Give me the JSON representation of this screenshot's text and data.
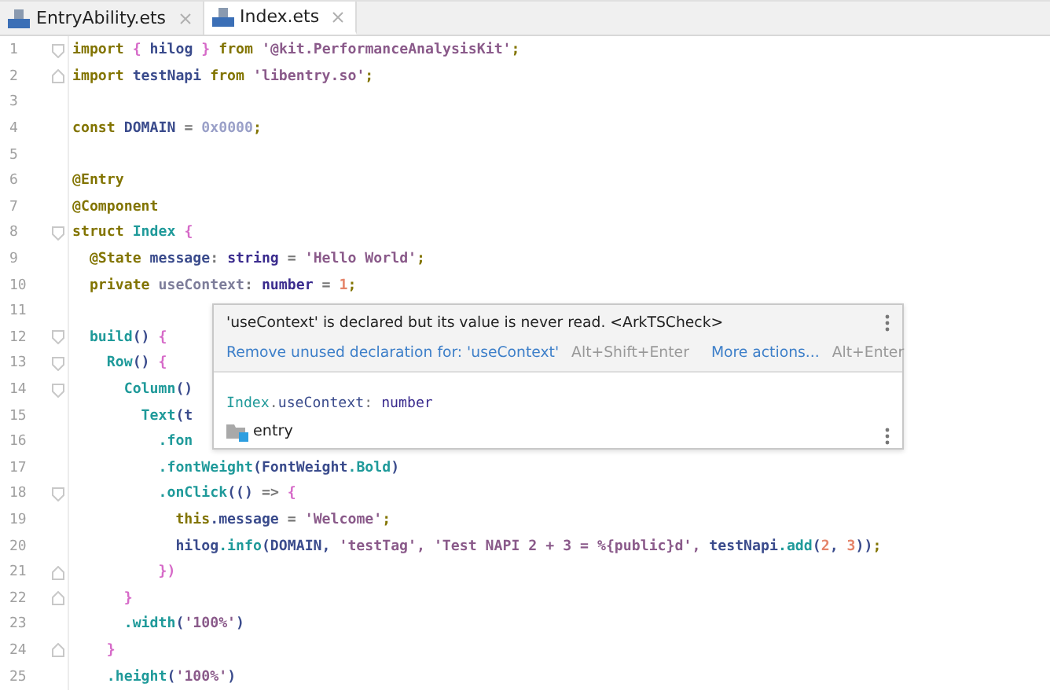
{
  "tabs": [
    {
      "label": "EntryAbility.ets",
      "selected": false
    },
    {
      "label": "Index.ets",
      "selected": true
    }
  ],
  "editor": {
    "lines": [
      {
        "number": "1",
        "kind": "fold_start",
        "tokens": [
          {
            "t": "import",
            "kind": "kw"
          },
          {
            "t": " { ",
            "kind": "brace"
          },
          {
            "t": "hilog",
            "kind": "id"
          },
          {
            "t": " } ",
            "kind": "brace"
          },
          {
            "t": "from",
            "kind": "kw"
          },
          {
            "t": " '@kit.PerformanceAnalysisKit'",
            "kind": "str"
          },
          {
            "t": ";",
            "kind": "kw"
          }
        ]
      },
      {
        "number": "2",
        "kind": "fold_end",
        "tokens": [
          {
            "t": "import",
            "kind": "kw"
          },
          {
            "t": " testNapi ",
            "kind": "id"
          },
          {
            "t": "from",
            "kind": "kw"
          },
          {
            "t": " 'libentry.so'",
            "kind": "str"
          },
          {
            "t": ";",
            "kind": "kw"
          }
        ]
      },
      {
        "number": "3",
        "kind": "plain"
      },
      {
        "number": "4",
        "kind": "plain",
        "tokens": [
          {
            "t": "const",
            "kind": "kw"
          },
          {
            "t": " DOMAIN ",
            "kind": "id"
          },
          {
            "t": "= ",
            "kind": "punct"
          },
          {
            "t": "0x0000",
            "kind": "numlite"
          },
          {
            "t": ";",
            "kind": "kw"
          }
        ]
      },
      {
        "number": "5",
        "kind": "plain"
      },
      {
        "number": "6",
        "kind": "plain",
        "tokens": [
          {
            "t": "@Entry",
            "kind": "kw"
          }
        ]
      },
      {
        "number": "7",
        "kind": "plain",
        "tokens": [
          {
            "t": "@Component",
            "kind": "kw"
          }
        ]
      },
      {
        "number": "8",
        "kind": "fold_start",
        "tokens": [
          {
            "t": "struct",
            "kind": "kw"
          },
          {
            "t": " Index ",
            "kind": "fn"
          },
          {
            "t": "{",
            "kind": "brace"
          }
        ]
      },
      {
        "number": "9",
        "kind": "plain",
        "tokens": [
          {
            "t": "  @State ",
            "kind": "kw"
          },
          {
            "t": "message",
            "kind": "id"
          },
          {
            "t": ": ",
            "kind": "punct"
          },
          {
            "t": "string",
            "kind": "type"
          },
          {
            "t": " = ",
            "kind": "punct"
          },
          {
            "t": "'Hello World'",
            "kind": "str"
          },
          {
            "t": ";",
            "kind": "kw"
          }
        ]
      },
      {
        "number": "10",
        "kind": "plain",
        "tokens": [
          {
            "t": "  private ",
            "kind": "kw"
          },
          {
            "t": "useContext",
            "kind": "unused"
          },
          {
            "t": ": ",
            "kind": "punct"
          },
          {
            "t": "number",
            "kind": "type"
          },
          {
            "t": " = ",
            "kind": "punct"
          },
          {
            "t": "1",
            "kind": "num"
          },
          {
            "t": ";",
            "kind": "kw"
          }
        ]
      },
      {
        "number": "11",
        "kind": "plain"
      },
      {
        "number": "12",
        "kind": "fold_start",
        "tokens": [
          {
            "t": "  build",
            "kind": "fn"
          },
          {
            "t": "() ",
            "kind": "id"
          },
          {
            "t": "{",
            "kind": "brace"
          }
        ]
      },
      {
        "number": "13",
        "kind": "fold_start",
        "tokens": [
          {
            "t": "    Row",
            "kind": "fn"
          },
          {
            "t": "() ",
            "kind": "id"
          },
          {
            "t": "{",
            "kind": "brace"
          }
        ]
      },
      {
        "number": "14",
        "kind": "fold_start",
        "tokens": [
          {
            "t": "      Column",
            "kind": "fn"
          },
          {
            "t": "()",
            "kind": "id"
          }
        ]
      },
      {
        "number": "15",
        "kind": "plain",
        "tokens": [
          {
            "t": "        Text",
            "kind": "fn"
          },
          {
            "t": "(t",
            "kind": "id"
          }
        ]
      },
      {
        "number": "16",
        "kind": "plain",
        "tokens": [
          {
            "t": "          .fon",
            "kind": "fn"
          }
        ]
      },
      {
        "number": "17",
        "kind": "plain",
        "tokens": [
          {
            "t": "          .fontWeight",
            "kind": "fn"
          },
          {
            "t": "(FontWeight",
            "kind": "id"
          },
          {
            "t": ".Bold",
            "kind": "fn"
          },
          {
            "t": ")",
            "kind": "id"
          }
        ]
      },
      {
        "number": "18",
        "kind": "fold_start",
        "tokens": [
          {
            "t": "          .onClick",
            "kind": "fn"
          },
          {
            "t": "(() ",
            "kind": "id"
          },
          {
            "t": "=> ",
            "kind": "punct"
          },
          {
            "t": "{",
            "kind": "brace"
          }
        ]
      },
      {
        "number": "19",
        "kind": "plain",
        "tokens": [
          {
            "t": "            this",
            "kind": "kw"
          },
          {
            "t": ".message ",
            "kind": "id"
          },
          {
            "t": "= ",
            "kind": "punct"
          },
          {
            "t": "'Welcome'",
            "kind": "str"
          },
          {
            "t": ";",
            "kind": "kw"
          }
        ]
      },
      {
        "number": "20",
        "kind": "plain",
        "tokens": [
          {
            "t": "            hilog",
            "kind": "id"
          },
          {
            "t": ".info",
            "kind": "fn"
          },
          {
            "t": "(DOMAIN, ",
            "kind": "id"
          },
          {
            "t": "'testTag', 'Test NAPI 2 + 3 = %{public}d', ",
            "kind": "str"
          },
          {
            "t": "testNapi",
            "kind": "id"
          },
          {
            "t": ".add",
            "kind": "fn"
          },
          {
            "t": "(",
            "kind": "id"
          },
          {
            "t": "2",
            "kind": "num"
          },
          {
            "t": ", ",
            "kind": "id"
          },
          {
            "t": "3",
            "kind": "num"
          },
          {
            "t": "))",
            "kind": "id"
          },
          {
            "t": ";",
            "kind": "kw"
          }
        ]
      },
      {
        "number": "21",
        "kind": "fold_end",
        "tokens": [
          {
            "t": "          })",
            "kind": "brace"
          }
        ]
      },
      {
        "number": "22",
        "kind": "fold_end",
        "tokens": [
          {
            "t": "      }",
            "kind": "brace"
          }
        ]
      },
      {
        "number": "23",
        "kind": "plain",
        "tokens": [
          {
            "t": "      .width",
            "kind": "fn"
          },
          {
            "t": "(",
            "kind": "id"
          },
          {
            "t": "'100%'",
            "kind": "str"
          },
          {
            "t": ")",
            "kind": "id"
          }
        ]
      },
      {
        "number": "24",
        "kind": "fold_end",
        "tokens": [
          {
            "t": "    }",
            "kind": "brace"
          }
        ]
      },
      {
        "number": "25",
        "kind": "plain",
        "tokens": [
          {
            "t": "    .height",
            "kind": "fn"
          },
          {
            "t": "(",
            "kind": "id"
          },
          {
            "t": "'100%'",
            "kind": "str"
          },
          {
            "t": ")",
            "kind": "id"
          }
        ]
      }
    ]
  },
  "popup": {
    "message": "'useContext' is declared but its value is never read. <ArkTSCheck>",
    "actions": [
      {
        "label": "Remove unused declaration for: 'useContext'",
        "shortcut": "Alt+Shift+Enter"
      },
      {
        "label": "More actions...",
        "shortcut": "Alt+Enter"
      }
    ],
    "signature": [
      {
        "t": "Index",
        "kind": "fn"
      },
      {
        "t": ".",
        "kind": "punct"
      },
      {
        "t": "useContext",
        "kind": "id"
      },
      {
        "t": ": ",
        "kind": "punct"
      },
      {
        "t": "number",
        "kind": "type"
      }
    ],
    "module": "entry"
  }
}
